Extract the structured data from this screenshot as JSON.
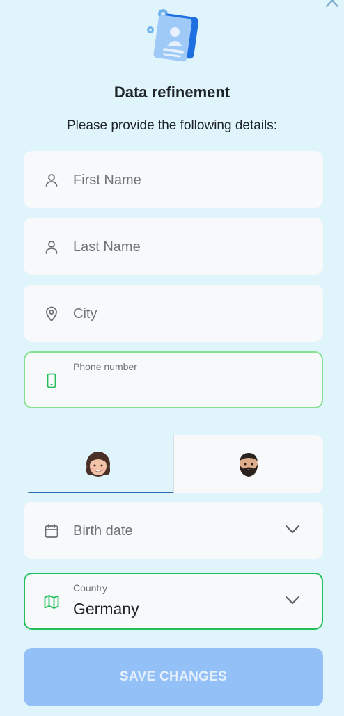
{
  "header": {
    "title": "Data refinement",
    "subtitle": "Please provide the following details:"
  },
  "fields": {
    "first_name": {
      "placeholder": "First Name",
      "icon": "user-icon"
    },
    "last_name": {
      "placeholder": "Last Name",
      "icon": "user-icon"
    },
    "city": {
      "placeholder": "City",
      "icon": "location-pin-icon"
    },
    "phone": {
      "label": "Phone number",
      "value": "",
      "icon": "smartphone-icon"
    },
    "birth_date": {
      "placeholder": "Birth date",
      "icon": "calendar-icon"
    },
    "country": {
      "label": "Country",
      "value": "Germany",
      "icon": "map-icon"
    }
  },
  "gender": {
    "options": [
      {
        "icon": "woman-avatar-icon",
        "selected": true
      },
      {
        "icon": "man-avatar-icon",
        "selected": false
      }
    ]
  },
  "actions": {
    "save_label": "SAVE CHANGES"
  },
  "colors": {
    "background": "#e0f4fb",
    "field_bg": "#f8f9fa",
    "focus_border": "#86e08f",
    "active_border": "#22bf5a",
    "button_disabled": "#93c0f7",
    "gender_selected_underline": "#2b6eb0"
  }
}
